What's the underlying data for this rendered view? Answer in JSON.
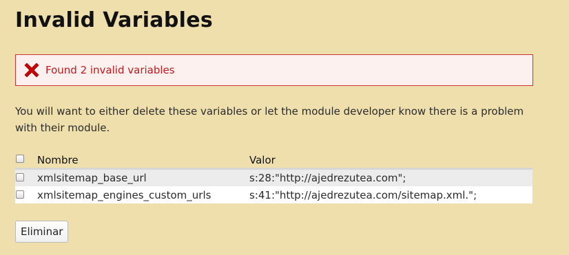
{
  "page": {
    "title": "Invalid Variables"
  },
  "message": {
    "type": "error",
    "icon": "error-x-icon",
    "color": "#c0181c",
    "text": "Found 2 invalid variables"
  },
  "description": "You will want to either delete these variables or let the module developer know there is a problem with their module.",
  "table": {
    "columns": [
      "Nombre",
      "Valor"
    ],
    "select_all_checked": false,
    "rows": [
      {
        "checked": false,
        "name": "xmlsitemap_base_url",
        "value": "s:28:\"http://ajedrezutea.com\";"
      },
      {
        "checked": false,
        "name": "xmlsitemap_engines_custom_urls",
        "value": "s:41:\"http://ajedrezutea.com/sitemap.xml.\";"
      }
    ]
  },
  "actions": {
    "delete_label": "Eliminar"
  }
}
